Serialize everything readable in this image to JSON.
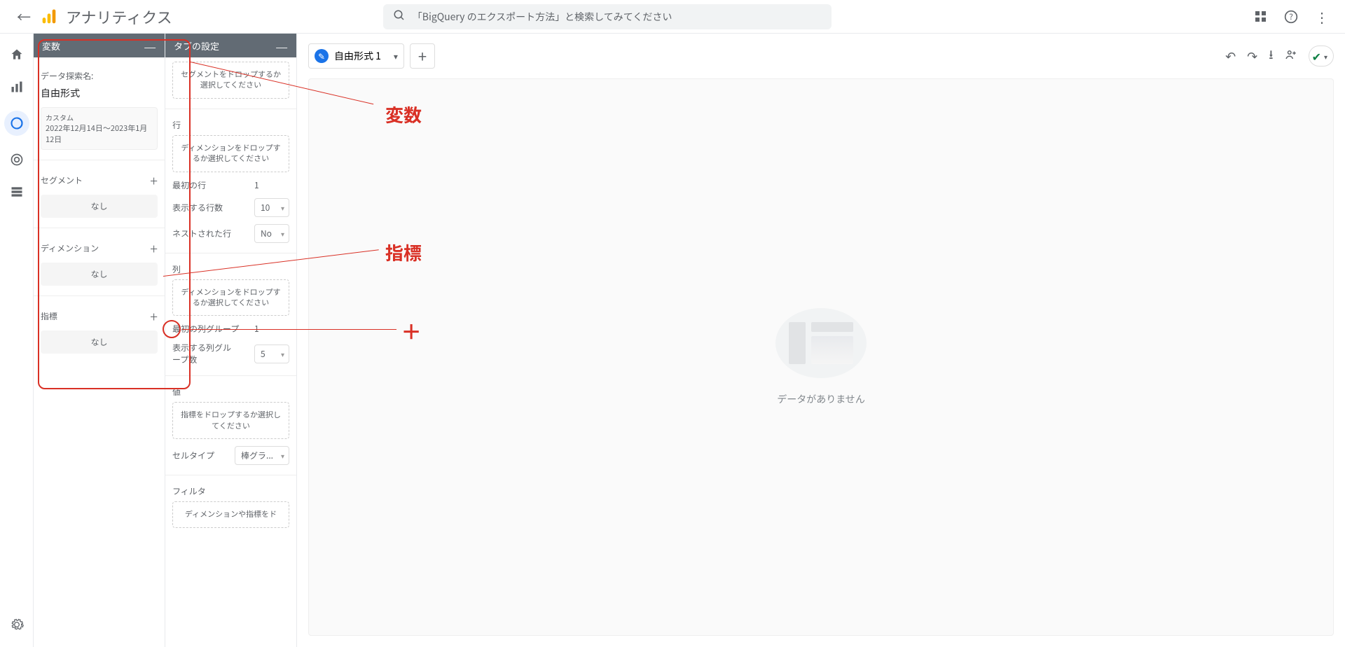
{
  "header": {
    "title": "アナリティクス",
    "search_placeholder": "「BigQuery のエクスポート方法」と検索してみてください"
  },
  "variables_panel": {
    "title": "変数",
    "name_label": "データ探索名:",
    "name_value": "自由形式",
    "range_label": "カスタム",
    "range_dates": "2022年12月14日～2023年1月12日",
    "segments_label": "セグメント",
    "none_text": "なし",
    "dimensions_label": "ディメンション",
    "metrics_label": "指標"
  },
  "tab_settings_panel": {
    "title": "タブの設定",
    "segment_drop": "セグメントをドロップするか選択してください",
    "rows_label": "行",
    "dimension_drop": "ディメンションをドロップするか選択してください",
    "first_row_label": "最初の行",
    "first_row_value": "1",
    "rows_show_label": "表示する行数",
    "rows_show_value": "10",
    "nested_rows_label": "ネストされた行",
    "nested_rows_value": "No",
    "cols_label": "列",
    "first_col_group_label": "最初の列グループ",
    "first_col_group_value": "1",
    "col_groups_label": "表示する列グループ数",
    "col_groups_value": "5",
    "values_label": "値",
    "metrics_drop": "指標をドロップするか選択してください",
    "cell_type_label": "セルタイプ",
    "cell_type_value": "棒グラ...",
    "filter_label": "フィルタ",
    "filter_drop": "ディメンションや指標をド"
  },
  "tab": {
    "name": "自由形式 1"
  },
  "canvas": {
    "empty_text": "データがありません"
  },
  "annotations": {
    "var_label": "変数",
    "metrics_label": "指標"
  }
}
